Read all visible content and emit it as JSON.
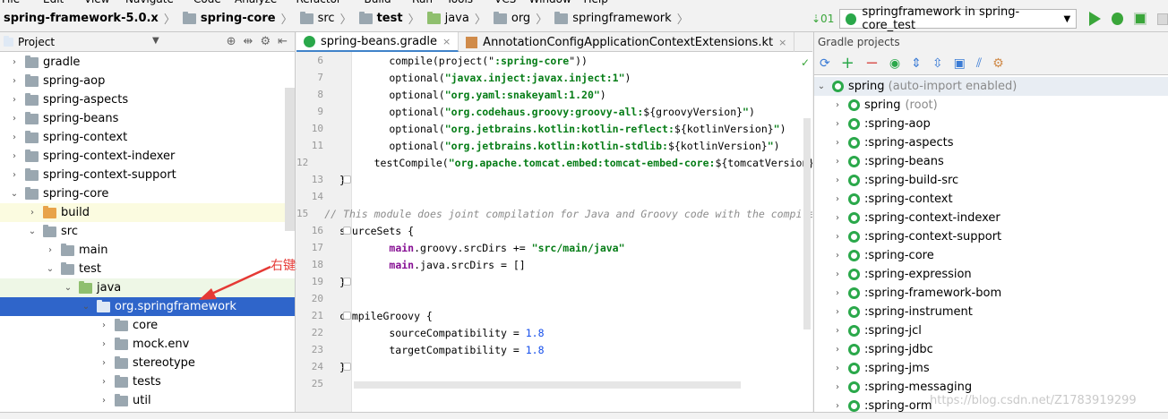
{
  "menubar": [
    "File",
    "Edit",
    "View",
    "Navigate",
    "Code",
    "Analyze",
    "Refactor",
    "Build",
    "Run",
    "Tools",
    "VCS",
    "Window",
    "Help"
  ],
  "breadcrumbs": [
    "spring-framework-5.0.x",
    "spring-core",
    "src",
    "test",
    "java",
    "org",
    "springframework"
  ],
  "run_config": {
    "label": "springframework in spring-core_test"
  },
  "project_panel": {
    "title": "Project",
    "tree": [
      {
        "label": "gradle",
        "indent": 0,
        "arrow": "›",
        "icon": "grey"
      },
      {
        "label": "spring-aop",
        "indent": 0,
        "arrow": "›",
        "icon": "grey"
      },
      {
        "label": "spring-aspects",
        "indent": 0,
        "arrow": "›",
        "icon": "grey"
      },
      {
        "label": "spring-beans",
        "indent": 0,
        "arrow": "›",
        "icon": "grey"
      },
      {
        "label": "spring-context",
        "indent": 0,
        "arrow": "›",
        "icon": "grey"
      },
      {
        "label": "spring-context-indexer",
        "indent": 0,
        "arrow": "›",
        "icon": "grey"
      },
      {
        "label": "spring-context-support",
        "indent": 0,
        "arrow": "›",
        "icon": "grey"
      },
      {
        "label": "spring-core",
        "indent": 0,
        "arrow": "⌄",
        "icon": "grey"
      },
      {
        "label": "build",
        "indent": 1,
        "arrow": "›",
        "icon": "orange"
      },
      {
        "label": "src",
        "indent": 1,
        "arrow": "⌄",
        "icon": "grey"
      },
      {
        "label": "main",
        "indent": 2,
        "arrow": "›",
        "icon": "grey"
      },
      {
        "label": "test",
        "indent": 2,
        "arrow": "⌄",
        "icon": "grey"
      },
      {
        "label": "java",
        "indent": 3,
        "arrow": "⌄",
        "icon": "green"
      },
      {
        "label": "org.springframework",
        "indent": 4,
        "arrow": "⌄",
        "icon": "white"
      },
      {
        "label": "core",
        "indent": 5,
        "arrow": "›",
        "icon": "grey"
      },
      {
        "label": "mock.env",
        "indent": 5,
        "arrow": "›",
        "icon": "grey"
      },
      {
        "label": "stereotype",
        "indent": 5,
        "arrow": "›",
        "icon": "grey"
      },
      {
        "label": "tests",
        "indent": 5,
        "arrow": "›",
        "icon": "grey"
      },
      {
        "label": "util",
        "indent": 5,
        "arrow": "›",
        "icon": "grey"
      }
    ]
  },
  "annotation": {
    "text": "右键run",
    "color": "#e53935"
  },
  "editor": {
    "tabs": [
      {
        "label": "spring-beans.gradle",
        "active": true
      },
      {
        "label": "AnnotationConfigApplicationContextExtensions.kt",
        "active": false
      }
    ],
    "lines": [
      {
        "n": "6",
        "code": [
          [
            "",
            "        compile(project(\""
          ],
          [
            "str",
            ":spring-core"
          ],
          [
            "",
            "\"))"
          ]
        ]
      },
      {
        "n": "7",
        "code": [
          [
            "",
            "        optional("
          ],
          [
            "str",
            "\"javax.inject:javax.inject:1\""
          ],
          [
            "",
            ")"
          ]
        ]
      },
      {
        "n": "8",
        "code": [
          [
            "",
            "        optional("
          ],
          [
            "str",
            "\"org.yaml:snakeyaml:1.20\""
          ],
          [
            "",
            ")"
          ]
        ]
      },
      {
        "n": "9",
        "code": [
          [
            "",
            "        optional("
          ],
          [
            "str",
            "\"org.codehaus.groovy:groovy-all:"
          ],
          [
            "",
            "${groovyVersion}"
          ],
          [
            "str",
            "\""
          ],
          [
            "",
            ")"
          ]
        ]
      },
      {
        "n": "10",
        "code": [
          [
            "",
            "        optional("
          ],
          [
            "str",
            "\"org.jetbrains.kotlin:kotlin-reflect:"
          ],
          [
            "",
            "${kotlinVersion}"
          ],
          [
            "str",
            "\""
          ],
          [
            "",
            ")"
          ]
        ]
      },
      {
        "n": "11",
        "code": [
          [
            "",
            "        optional("
          ],
          [
            "str",
            "\"org.jetbrains.kotlin:kotlin-stdlib:"
          ],
          [
            "",
            "${kotlinVersion}"
          ],
          [
            "str",
            "\""
          ],
          [
            "",
            ")"
          ]
        ]
      },
      {
        "n": "12",
        "code": [
          [
            "",
            "        testCompile("
          ],
          [
            "str",
            "\"org.apache.tomcat.embed:tomcat-embed-core:"
          ],
          [
            "",
            "${tomcatVersion}"
          ],
          [
            "str",
            "\""
          ],
          [
            "",
            ")"
          ]
        ]
      },
      {
        "n": "13",
        "code": [
          [
            "",
            "}"
          ]
        ]
      },
      {
        "n": "14",
        "code": [
          [
            "",
            ""
          ]
        ]
      },
      {
        "n": "15",
        "code": [
          [
            "cmt",
            "// This module does joint compilation for Java and Groovy code with the compileGroovy"
          ]
        ]
      },
      {
        "n": "16",
        "code": [
          [
            "",
            "sourceSets {"
          ]
        ]
      },
      {
        "n": "17",
        "code": [
          [
            "",
            "        "
          ],
          [
            "kw",
            "main"
          ],
          [
            "",
            ".groovy.srcDirs += "
          ],
          [
            "str",
            "\"src/main/java\""
          ]
        ]
      },
      {
        "n": "18",
        "code": [
          [
            "",
            "        "
          ],
          [
            "kw",
            "main"
          ],
          [
            "",
            ".java.srcDirs = []"
          ]
        ]
      },
      {
        "n": "19",
        "code": [
          [
            "",
            "}"
          ]
        ]
      },
      {
        "n": "20",
        "code": [
          [
            "",
            ""
          ]
        ]
      },
      {
        "n": "21",
        "code": [
          [
            "",
            "compileGroovy {"
          ]
        ]
      },
      {
        "n": "22",
        "code": [
          [
            "",
            "        sourceCompatibility = "
          ],
          [
            "num",
            "1.8"
          ]
        ]
      },
      {
        "n": "23",
        "code": [
          [
            "",
            "        targetCompatibility = "
          ],
          [
            "num",
            "1.8"
          ]
        ]
      },
      {
        "n": "24",
        "code": [
          [
            "",
            "}"
          ]
        ]
      },
      {
        "n": "25",
        "code": [
          [
            "",
            ""
          ]
        ]
      }
    ]
  },
  "gradle_panel": {
    "title": "Gradle projects",
    "root": {
      "label": "spring",
      "suffix": "(auto-import enabled)"
    },
    "items": [
      {
        "label": "spring",
        "suffix": "(root)"
      },
      {
        "label": ":spring-aop",
        "suffix": ""
      },
      {
        "label": ":spring-aspects",
        "suffix": ""
      },
      {
        "label": ":spring-beans",
        "suffix": ""
      },
      {
        "label": ":spring-build-src",
        "suffix": ""
      },
      {
        "label": ":spring-context",
        "suffix": ""
      },
      {
        "label": ":spring-context-indexer",
        "suffix": ""
      },
      {
        "label": ":spring-context-support",
        "suffix": ""
      },
      {
        "label": ":spring-core",
        "suffix": ""
      },
      {
        "label": ":spring-expression",
        "suffix": ""
      },
      {
        "label": ":spring-framework-bom",
        "suffix": ""
      },
      {
        "label": ":spring-instrument",
        "suffix": ""
      },
      {
        "label": ":spring-jcl",
        "suffix": ""
      },
      {
        "label": ":spring-jdbc",
        "suffix": ""
      },
      {
        "label": ":spring-jms",
        "suffix": ""
      },
      {
        "label": ":spring-messaging",
        "suffix": ""
      },
      {
        "label": ":spring-orm",
        "suffix": ""
      }
    ]
  },
  "watermark": "https://blog.csdn.net/Z1783919299"
}
